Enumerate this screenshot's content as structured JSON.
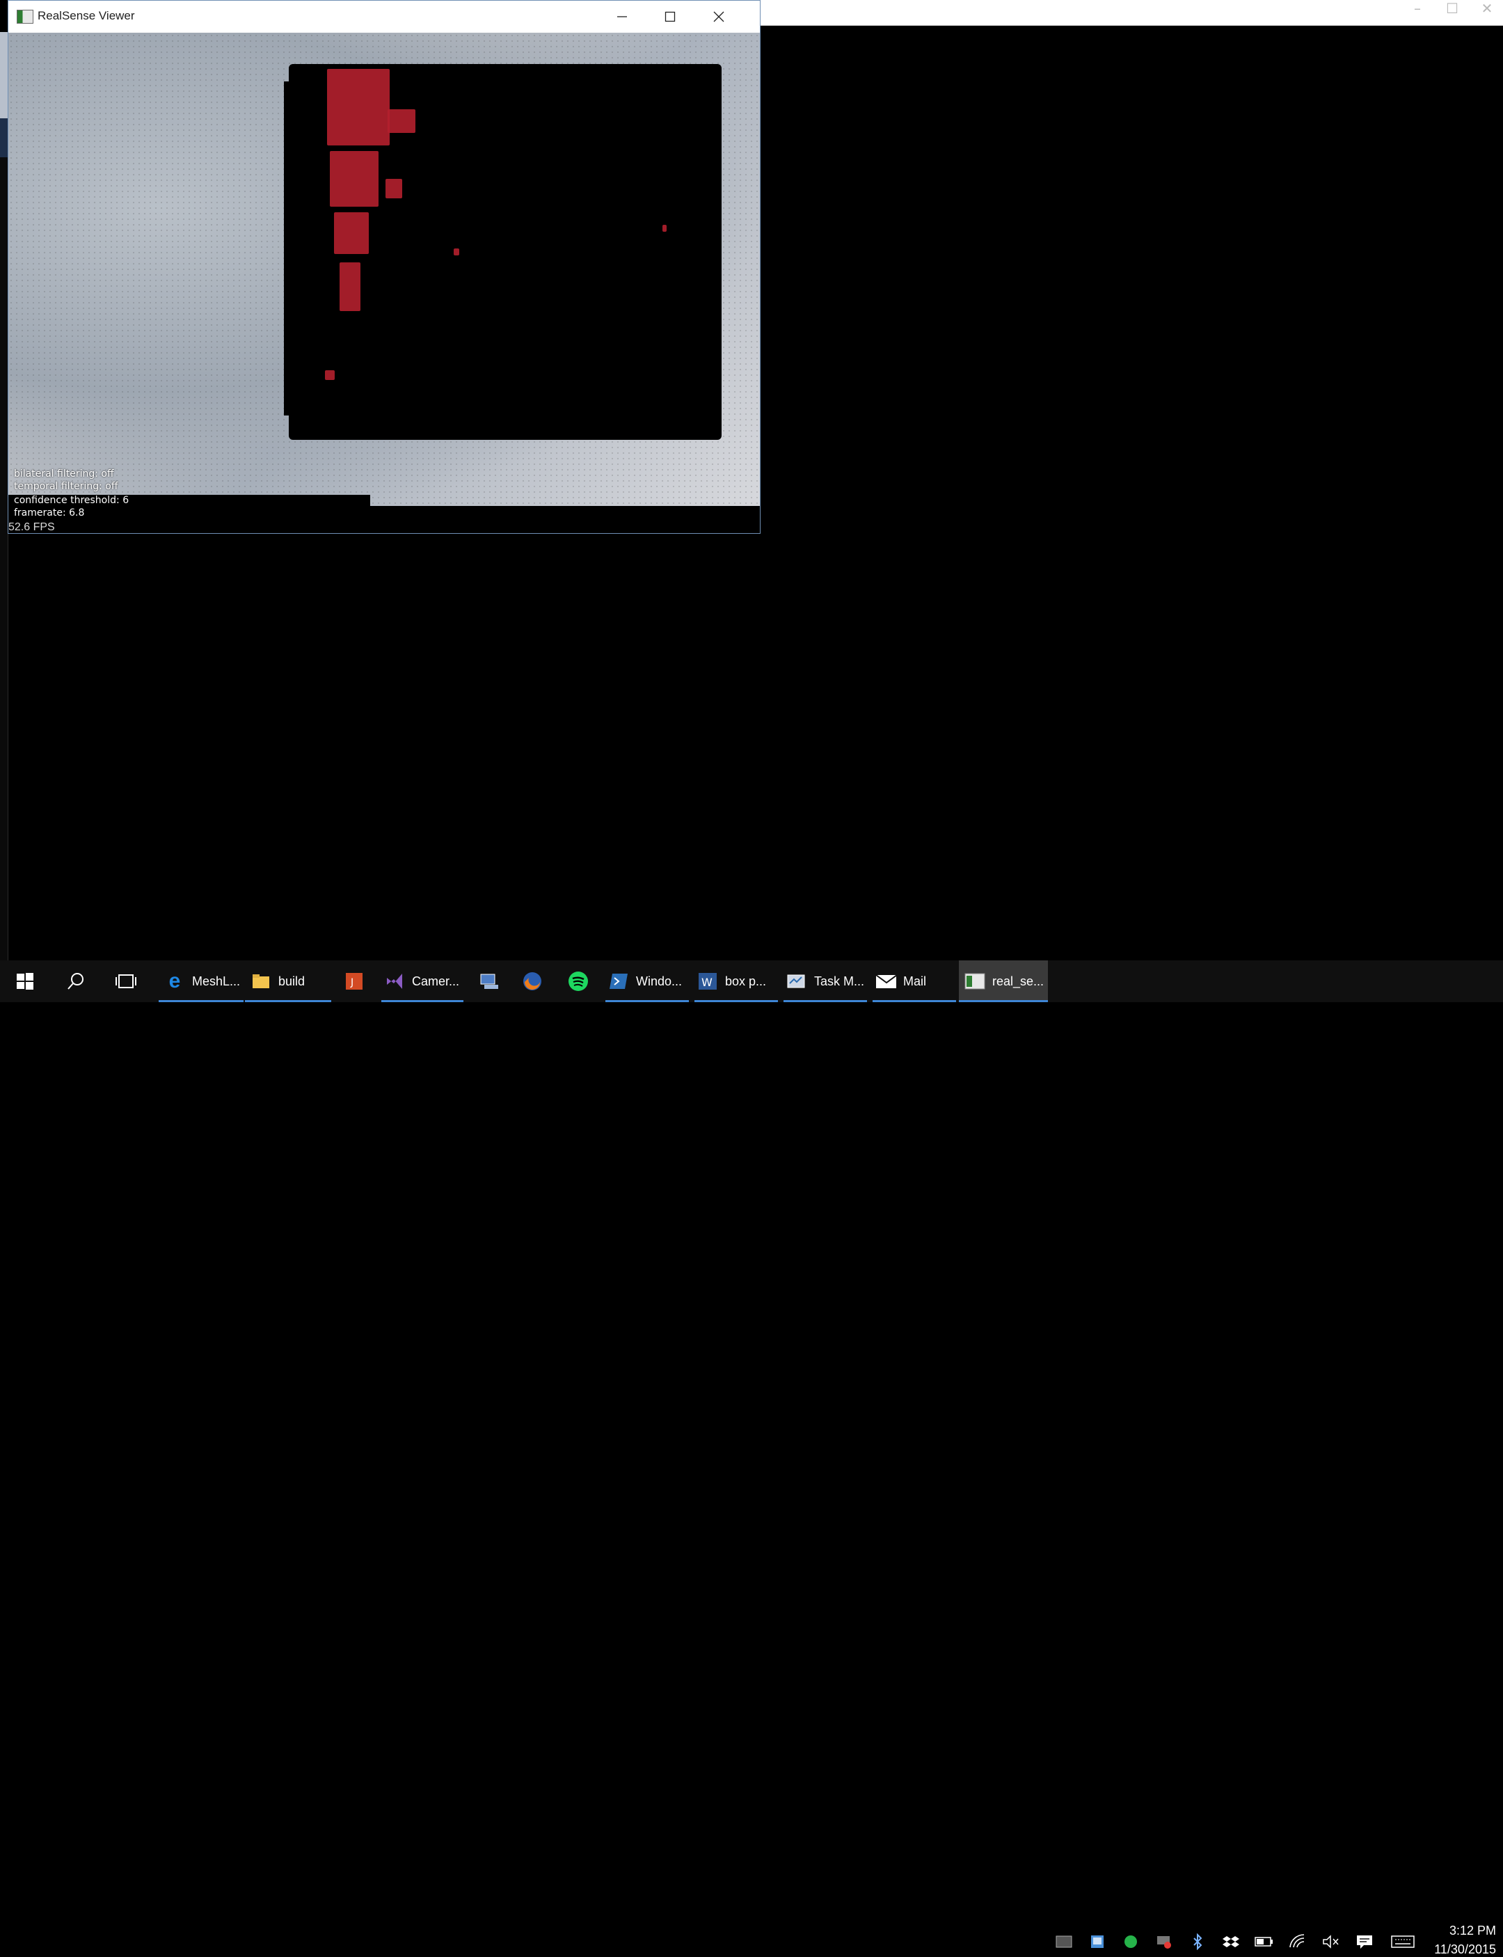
{
  "viewer": {
    "title": "RealSense Viewer",
    "overlay": {
      "bilateral": "bilateral filtering: off",
      "temporal": "temporal filtering: off",
      "confidence": "confidence threshold: 6",
      "framerate": "framerate: 6.8"
    },
    "fps": "52.6 FPS"
  },
  "taskbar": {
    "items": [
      {
        "label": "MeshL...",
        "icon": "edge-icon"
      },
      {
        "label": "build",
        "icon": "folder-icon"
      },
      {
        "label": "",
        "icon": "app-icon"
      },
      {
        "label": "Camer...",
        "icon": "visual-studio-icon"
      },
      {
        "label": "",
        "icon": "app-icon"
      },
      {
        "label": "",
        "icon": "firefox-icon"
      },
      {
        "label": "",
        "icon": "spotify-icon"
      },
      {
        "label": "Windo...",
        "icon": "powershell-icon"
      },
      {
        "label": "box p...",
        "icon": "word-icon"
      },
      {
        "label": "Task M...",
        "icon": "task-manager-icon"
      },
      {
        "label": "Mail",
        "icon": "mail-icon"
      },
      {
        "label": "real_se...",
        "icon": "realsense-icon"
      }
    ],
    "clock": {
      "time": "3:12 PM",
      "date": "11/30/2015"
    }
  },
  "colors": {
    "taskbar_bg": "#101010",
    "accent_blue": "#3e86d6",
    "red_data": "#b4202e"
  }
}
